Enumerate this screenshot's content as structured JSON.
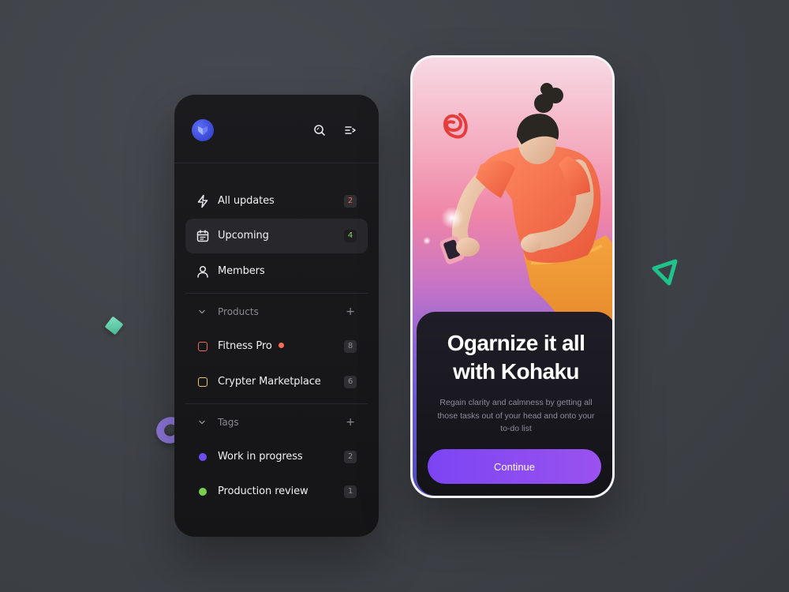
{
  "colors": {
    "accent_purple": "#8b4bf1",
    "badge_red": "#ff6a55",
    "badge_green": "#83d25a",
    "tag_purple": "#6f4cf0",
    "tag_green": "#7bcf4f",
    "project_red": "#ef6a5e",
    "project_yellow": "#e8c467"
  },
  "header": {
    "logo_icon": "shield-logo-icon",
    "search_icon": "search-icon",
    "menu_icon": "menu-collapse-icon"
  },
  "nav": {
    "items": [
      {
        "label": "All updates",
        "icon": "lightning-icon",
        "badge": "2"
      },
      {
        "label": "Upcoming",
        "icon": "calendar-icon",
        "badge": "4"
      },
      {
        "label": "Members",
        "icon": "user-icon"
      }
    ]
  },
  "products": {
    "label": "Products",
    "add": "+",
    "items": [
      {
        "label": "Fitness Pro",
        "badge": "8"
      },
      {
        "label": "Crypter Marketplace",
        "badge": "6"
      }
    ]
  },
  "tags": {
    "label": "Tags",
    "add": "+",
    "items": [
      {
        "label": "Work in progress",
        "badge": "2"
      },
      {
        "label": "Production review",
        "badge": "1"
      }
    ]
  },
  "onboarding": {
    "title": "Ogarnize it all\nwith Kohaku",
    "subtitle": "Regain clarity and calmness by getting all those tasks out of your head and onto your to-do list",
    "cta": "Continue"
  }
}
